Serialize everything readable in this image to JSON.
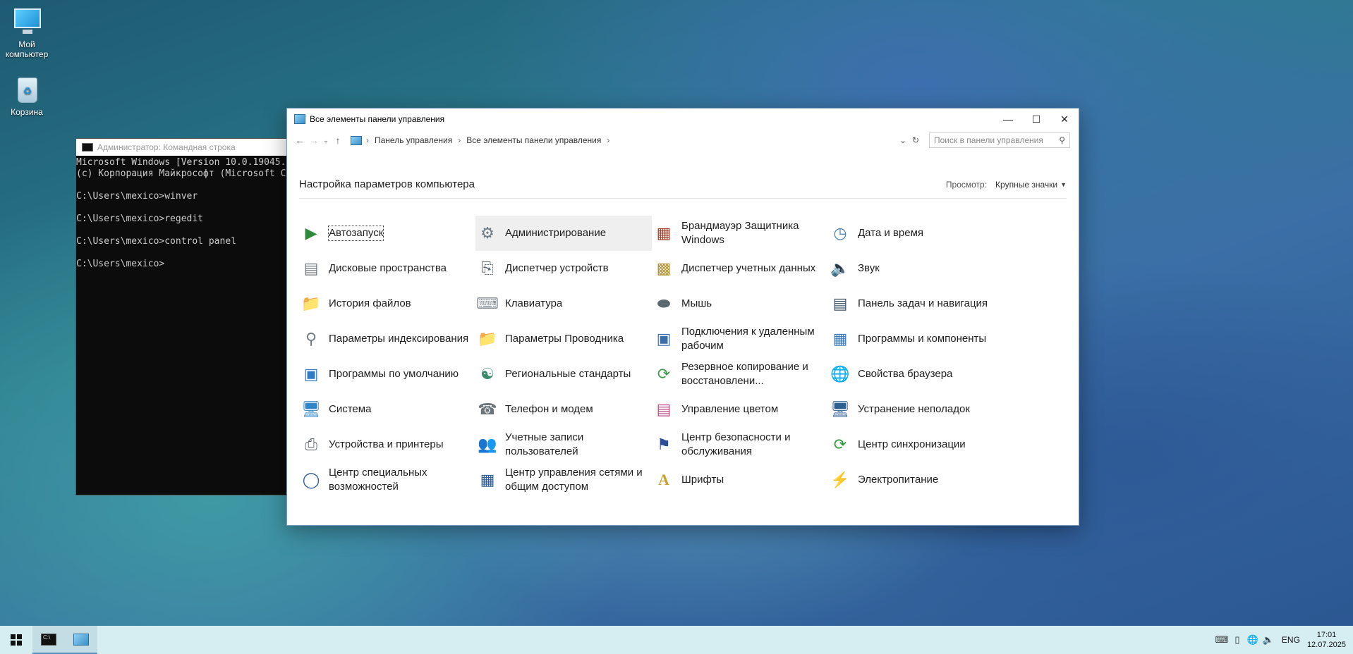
{
  "desktop": {
    "icons": [
      {
        "label": "Мой компьютер"
      },
      {
        "label": "Корзина"
      }
    ]
  },
  "cmd": {
    "title": "Администратор: Командная строка",
    "lines": "Microsoft Windows [Version 10.0.19045.\n(c) Корпорация Майкрософт (Microsoft C\n\nC:\\Users\\mexico>winver\n\nC:\\Users\\mexico>regedit\n\nC:\\Users\\mexico>control panel\n\nC:\\Users\\mexico>"
  },
  "control_panel": {
    "title": "Все элементы панели управления",
    "breadcrumb": [
      "Панель управления",
      "Все элементы панели управления"
    ],
    "search_placeholder": "Поиск в панели управления",
    "heading": "Настройка параметров компьютера",
    "view_label": "Просмотр:",
    "view_value": "Крупные значки",
    "items": [
      {
        "label": "Автозапуск",
        "icon": "autoplay-icon"
      },
      {
        "label": "Администрирование",
        "icon": "administrative-tools-icon"
      },
      {
        "label": "Брандмауэр Защитника Windows",
        "icon": "firewall-icon"
      },
      {
        "label": "Дата и время",
        "icon": "date-time-icon"
      },
      {
        "label": "Дисковые пространства",
        "icon": "storage-spaces-icon"
      },
      {
        "label": "Диспетчер устройств",
        "icon": "device-manager-icon"
      },
      {
        "label": "Диспетчер учетных данных",
        "icon": "credential-manager-icon"
      },
      {
        "label": "Звук",
        "icon": "sound-icon"
      },
      {
        "label": "История файлов",
        "icon": "file-history-icon"
      },
      {
        "label": "Клавиатура",
        "icon": "keyboard-icon"
      },
      {
        "label": "Мышь",
        "icon": "mouse-icon"
      },
      {
        "label": "Панель задач и навигация",
        "icon": "taskbar-icon"
      },
      {
        "label": "Параметры индексирования",
        "icon": "indexing-icon"
      },
      {
        "label": "Параметры Проводника",
        "icon": "folder-options-icon"
      },
      {
        "label": "Подключения к удаленным рабочим",
        "icon": "remote-desktop-icon"
      },
      {
        "label": "Программы и компоненты",
        "icon": "programs-features-icon"
      },
      {
        "label": "Программы по умолчанию",
        "icon": "default-programs-icon"
      },
      {
        "label": "Региональные стандарты",
        "icon": "region-icon"
      },
      {
        "label": "Резервное копирование и восстановлени...",
        "icon": "backup-icon"
      },
      {
        "label": "Свойства браузера",
        "icon": "internet-options-icon"
      },
      {
        "label": "Система",
        "icon": "system-icon"
      },
      {
        "label": "Телефон и модем",
        "icon": "phone-modem-icon"
      },
      {
        "label": "Управление цветом",
        "icon": "color-management-icon"
      },
      {
        "label": "Устранение неполадок",
        "icon": "troubleshooting-icon"
      },
      {
        "label": "Устройства и принтеры",
        "icon": "devices-printers-icon"
      },
      {
        "label": "Учетные записи пользователей",
        "icon": "user-accounts-icon"
      },
      {
        "label": "Центр безопасности и обслуживания",
        "icon": "security-maintenance-icon"
      },
      {
        "label": "Центр синхронизации",
        "icon": "sync-center-icon"
      },
      {
        "label": "Центр специальных возможностей",
        "icon": "ease-of-access-icon"
      },
      {
        "label": "Центр управления сетями и общим доступом",
        "icon": "network-sharing-icon"
      },
      {
        "label": "Шрифты",
        "icon": "fonts-icon"
      },
      {
        "label": "Электропитание",
        "icon": "power-options-icon"
      }
    ]
  },
  "taskbar": {
    "lang": "ENG",
    "time": "17:01",
    "date": "12.07.2025"
  }
}
